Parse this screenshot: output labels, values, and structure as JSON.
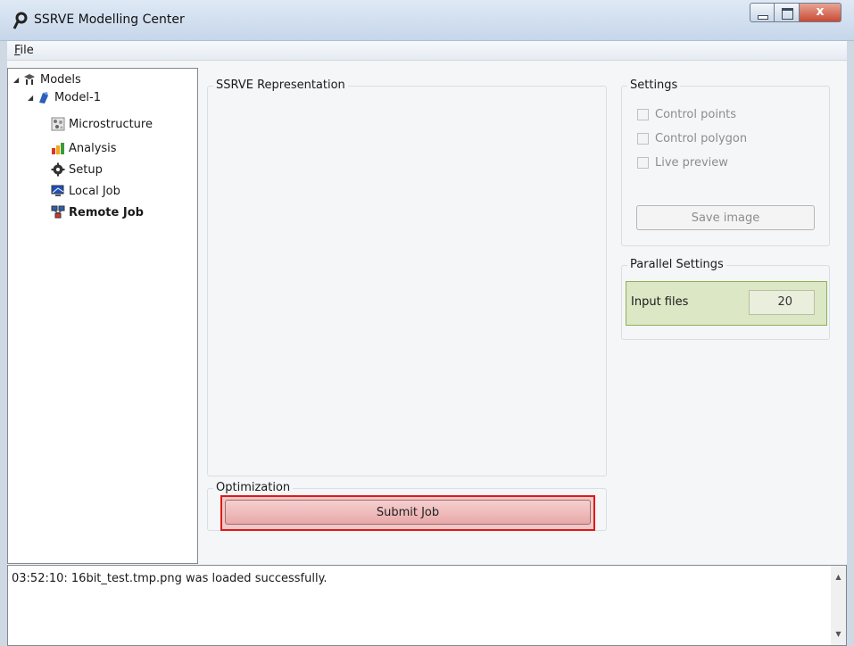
{
  "window": {
    "title": "SSRVE Modelling Center",
    "close_glyph": "x"
  },
  "menu": {
    "file_accel": "F",
    "file_rest": "ile"
  },
  "tree": {
    "root": {
      "label": "Models",
      "icon": "models-icon"
    },
    "model": {
      "label": "Model-1",
      "icon": "model-icon"
    },
    "children": [
      {
        "label": "Microstructure",
        "icon": "microstructure-icon",
        "bold": false
      },
      {
        "label": "Analysis",
        "icon": "analysis-icon",
        "bold": false
      },
      {
        "label": "Setup",
        "icon": "gear-icon",
        "bold": false
      },
      {
        "label": "Local Job",
        "icon": "monitor-icon",
        "bold": false
      },
      {
        "label": "Remote Job",
        "icon": "network-icon",
        "bold": true
      }
    ]
  },
  "representation": {
    "title": "SSRVE Representation"
  },
  "settings": {
    "title": "Settings",
    "control_points": "Control points",
    "control_polygon": "Control polygon",
    "live_preview": "Live preview",
    "save_image": "Save image"
  },
  "parallel": {
    "title": "Parallel Settings",
    "input_files_label": "Input files",
    "input_files_value": "20"
  },
  "optimization": {
    "title": "Optimization",
    "submit_label": "Submit Job"
  },
  "log": {
    "message": "03:52:10: 16bit_test.tmp.png was loaded successfully."
  },
  "colors": {
    "highlight_border": "#e01818",
    "submit_fill": "#e8a9a9",
    "input_highlight": "#dbe7c5"
  }
}
